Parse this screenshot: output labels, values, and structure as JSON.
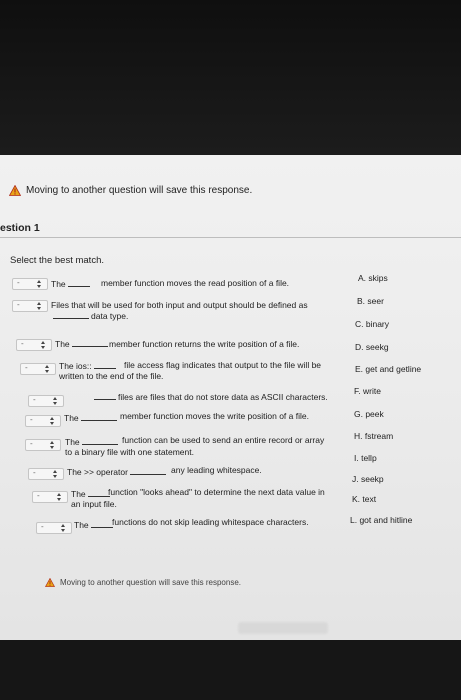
{
  "warning_top": "Moving to another question will save this response.",
  "question_title": "estion 1",
  "instruction": "Select the best match.",
  "select_placeholder": "-",
  "questions": [
    {
      "pre": "The",
      "post": "member function moves the read position of a file.",
      "line2": ""
    },
    {
      "pre": "Files that will be used for both input and output should be defined as",
      "post": "",
      "line2": "data type."
    },
    {
      "pre": "The",
      "post": "member function returns the write position of a file.",
      "line2": ""
    },
    {
      "pre": "The ios::",
      "post": "file access flag indicates that output to the file will be",
      "line2": "written to the end of the file."
    },
    {
      "pre": "",
      "post": "files are files that do not store data as ASCII characters.",
      "line2": ""
    },
    {
      "pre": "The",
      "post": "member function moves the write position of a file.",
      "line2": ""
    },
    {
      "pre": "The",
      "post": "function can be used to send an entire record or array",
      "line2": "to a binary file with one statement."
    },
    {
      "pre": "The >> operator",
      "post": "any leading whitespace.",
      "line2": ""
    },
    {
      "pre": "The",
      "post": "function \"looks ahead\" to determine the next data value in",
      "line2": "an input file."
    },
    {
      "pre": "The",
      "post": "functions do not skip leading whitespace characters.",
      "line2": ""
    }
  ],
  "answers": [
    "A. skips",
    "B. seer",
    "C. binary",
    "D. seekg",
    "E. get and getline",
    "F. write",
    "G. peek",
    "H. fstream",
    "I. tellp",
    "J. seekp",
    "K. text",
    "L. got and hitline"
  ],
  "warning_bottom": "Moving to another question will save this response.",
  "colors": {
    "warning_icon": "#e8a317",
    "warning_icon_mark": "#b02a1a"
  },
  "icons": {
    "warning": "warning-icon",
    "select_arrow": "updown-arrow-icon"
  }
}
